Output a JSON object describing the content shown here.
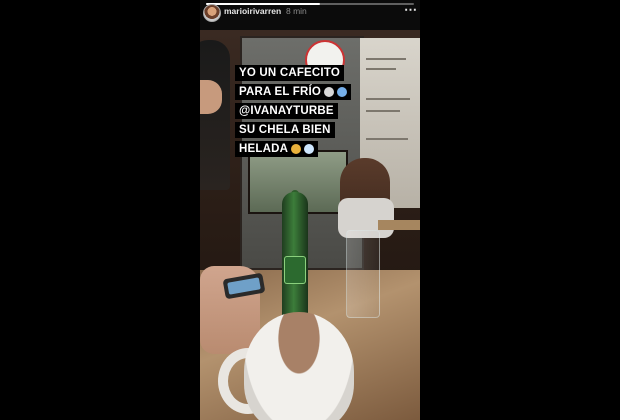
{
  "story": {
    "username": "marioirivarren",
    "time_ago": "8 min",
    "more_icon": "⋯",
    "progress": 0.55,
    "caption_lines": [
      "YO UN CAFECITO",
      "PARA EL FRÍO",
      "@IVANAYTURBE",
      "SU CHELA BIEN",
      "HELADA"
    ],
    "icons": {
      "avatar": "avatar-icon",
      "more": "more-options-icon"
    }
  }
}
